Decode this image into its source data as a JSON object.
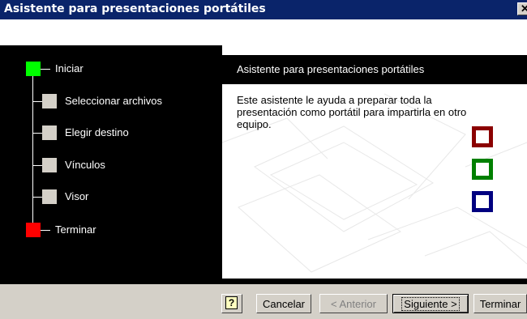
{
  "window": {
    "title": "Asistente para presentaciones portátiles",
    "close_glyph": "✕"
  },
  "steps": [
    {
      "label": "Iniciar",
      "state": "current",
      "color": "#00ff00"
    },
    {
      "label": "Seleccionar archivos",
      "state": "pending",
      "color": "#d4d0c8"
    },
    {
      "label": "Elegir destino",
      "state": "pending",
      "color": "#d4d0c8"
    },
    {
      "label": "Vínculos",
      "state": "pending",
      "color": "#d4d0c8"
    },
    {
      "label": "Visor",
      "state": "pending",
      "color": "#d4d0c8"
    },
    {
      "label": "Terminar",
      "state": "end",
      "color": "#ff0000"
    }
  ],
  "panel": {
    "header": "Asistente para presentaciones portátiles",
    "body": "Este asistente le ayuda a preparar toda la presentación como portátil para impartirla en otro equipo.",
    "icons": [
      {
        "name": "red-square-icon",
        "color": "#8b0000"
      },
      {
        "name": "green-square-icon",
        "color": "#008000"
      },
      {
        "name": "blue-square-icon",
        "color": "#000080"
      }
    ]
  },
  "buttons": {
    "help": "?",
    "cancel": "Cancelar",
    "back": "< Anterior",
    "next": "Siguiente >",
    "finish": "Terminar"
  }
}
